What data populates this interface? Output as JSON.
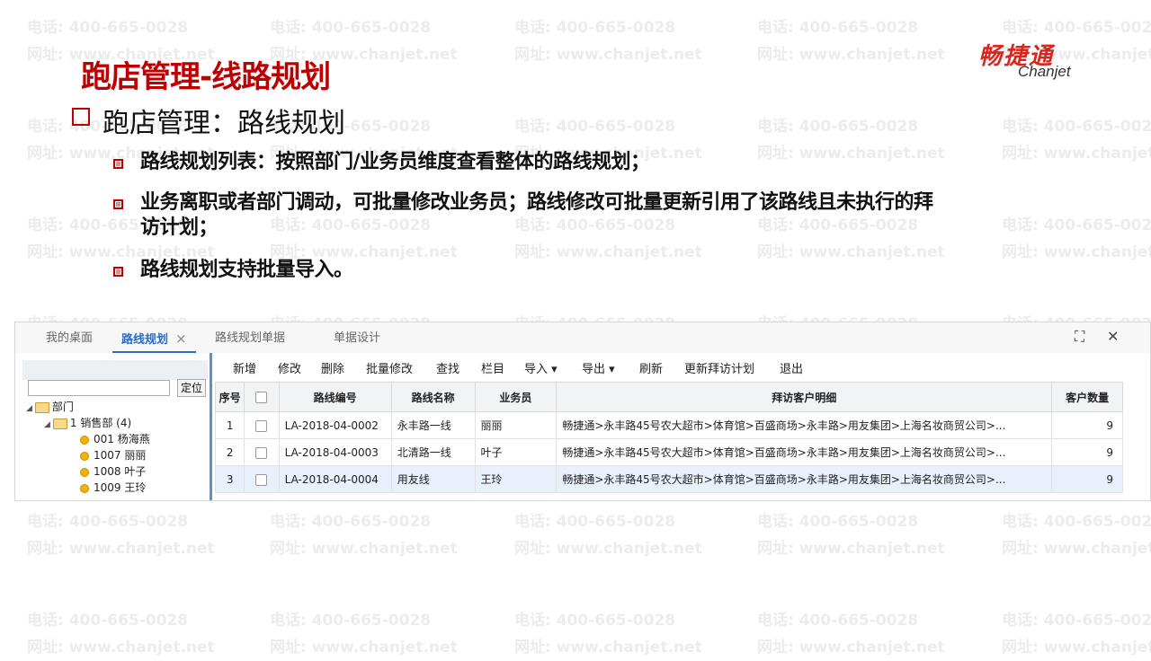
{
  "watermark": {
    "phone": "电话: 400-665-0028",
    "site": "网址: www.chanjet.net"
  },
  "slide": {
    "title": "跑店管理-线路规划",
    "heading": "跑店管理：路线规划",
    "bullets": [
      "路线规划列表：按照部门/业务员维度查看整体的路线规划；",
      "业务离职或者部门调动，可批量修改业务员；路线修改可批量更新引用了该路线且未执行的拜",
      "访计划；",
      "路线规划支持批量导入。"
    ]
  },
  "logo": {
    "cn": "畅捷通",
    "en": "Chanjet"
  },
  "app": {
    "tabs": [
      {
        "label": "我的桌面",
        "active": false
      },
      {
        "label": "路线规划",
        "active": true,
        "close": "×"
      },
      {
        "label": "路线规划单据",
        "active": false
      },
      {
        "label": "单据设计",
        "active": false
      }
    ],
    "window_buttons": {
      "maximize": "⛶",
      "close": "✕"
    },
    "left": {
      "locate_label": "定位",
      "tree": {
        "root": "部门",
        "dept": "1 销售部 (4)",
        "members": [
          "001 杨海燕",
          "1007 丽丽",
          "1008 叶子",
          "1009 王玲"
        ]
      }
    },
    "toolbar": [
      "新增",
      "修改",
      "删除",
      "批量修改",
      "查找",
      "栏目",
      "导入 ▾",
      "导出 ▾",
      "刷新",
      "更新拜访计划",
      "退出"
    ],
    "table": {
      "headers": [
        "序号",
        "",
        "路线编号",
        "路线名称",
        "业务员",
        "拜访客户明细",
        "客户数量"
      ],
      "rows": [
        {
          "idx": "1",
          "code": "LA-2018-04-0002",
          "name": "永丰路一线",
          "staff": "丽丽",
          "detail": "畅捷通>永丰路45号农大超市>体育馆>百盛商场>永丰路>用友集团>上海名妆商贸公司>...",
          "count": "9"
        },
        {
          "idx": "2",
          "code": "LA-2018-04-0003",
          "name": "北清路一线",
          "staff": "叶子",
          "detail": "畅捷通>永丰路45号农大超市>体育馆>百盛商场>永丰路>用友集团>上海名妆商贸公司>...",
          "count": "9"
        },
        {
          "idx": "3",
          "code": "LA-2018-04-0004",
          "name": "用友线",
          "staff": "王玲",
          "detail": "畅捷通>永丰路45号农大超市>体育馆>百盛商场>永丰路>用友集团>上海名妆商贸公司>...",
          "count": "9"
        }
      ]
    }
  },
  "colors": {
    "accent_red": "#c00000",
    "tab_blue": "#2a6cc8",
    "selected_row": "#e7f0fb"
  }
}
